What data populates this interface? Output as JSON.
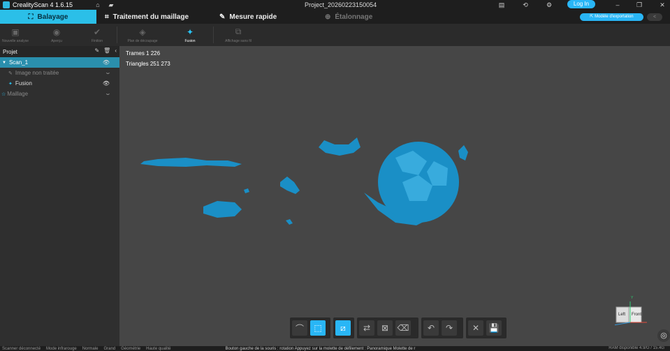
{
  "app": {
    "title": "CrealityScan 4 1.6.15",
    "project": "Project_20260223150054",
    "login_label": "Log In"
  },
  "tabs": [
    {
      "label": "Balayage"
    },
    {
      "label": "Traitement du maillage"
    },
    {
      "label": "Mesure rapide"
    },
    {
      "label": "Étalonnage"
    }
  ],
  "export_label": "Modèle d'exportation",
  "toolbar": [
    {
      "label": "Nouvelle analyse"
    },
    {
      "label": "Aperçu"
    },
    {
      "label": "Finition"
    },
    {
      "label": "Plan de découpage"
    },
    {
      "label": "Fusion"
    },
    {
      "label": "Affichage sans fil"
    }
  ],
  "sidebar": {
    "header": "Projet",
    "items": [
      {
        "label": "Scan_1"
      },
      {
        "label": "Image non traitée"
      },
      {
        "label": "Fusion"
      },
      {
        "label": "Maillage"
      }
    ]
  },
  "stats": {
    "frames": "Trames 1 226",
    "triangles": "Triangles 251 273"
  },
  "gizmo": {
    "left": "Left",
    "front": "Front",
    "y": "Y"
  },
  "status": {
    "items": [
      "Scanner déconnecté",
      "Mode infrarouge",
      "Normale",
      "Grand",
      "Géométrie",
      "Haute qualité"
    ],
    "hint": "Bouton gauche de la souris : rotation     Appuyez sur la molette de défilement : Panoramique     Molette de r",
    "ram": "RAM disponible 4.9/G / 15.4G"
  },
  "colors": {
    "accent": "#2bbfe8",
    "model": "#1a8fc6"
  }
}
